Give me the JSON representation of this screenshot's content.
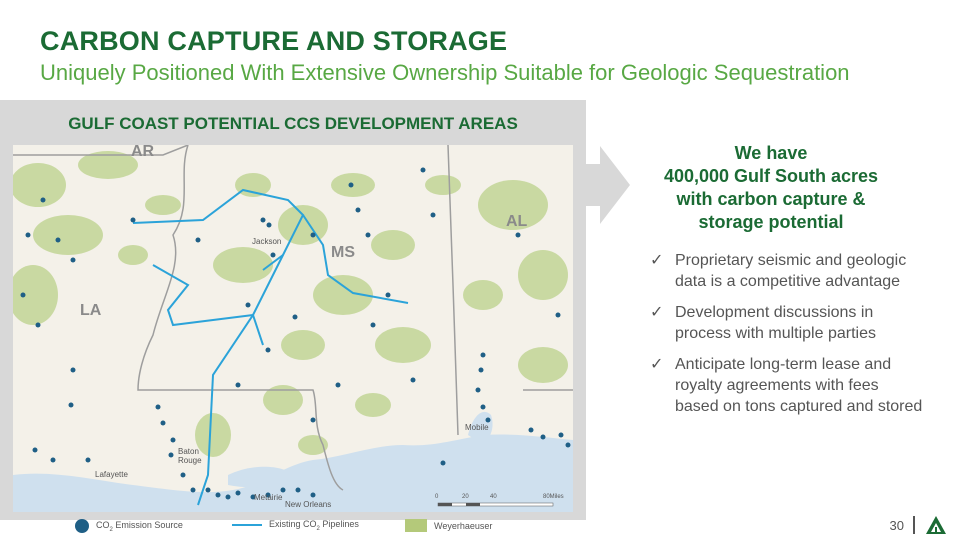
{
  "header": {
    "title": "CARBON CAPTURE AND STORAGE",
    "subtitle": "Uniquely Positioned With Extensive Ownership Suitable for Geologic Sequestration"
  },
  "map_panel": {
    "title": "GULF COAST POTENTIAL CCS DEVELOPMENT AREAS",
    "state_labels": [
      "AR",
      "AL",
      "MS",
      "LA"
    ],
    "city_labels": [
      "Jackson",
      "Mobile",
      "Baton Rouge",
      "Lafayette",
      "Metairie",
      "New Orleans"
    ],
    "scale": {
      "ticks": [
        "0",
        "20",
        "40",
        "80Miles"
      ]
    },
    "colors": {
      "water": "#cfe0ee",
      "land": "#f4f1e9",
      "ownership": "#c9d9a2",
      "pipeline": "#2ba3d9",
      "emission": "#1f5f86",
      "border": "#9e9e9e"
    }
  },
  "legend": {
    "emission_label": "CO",
    "emission_sub": "2",
    "emission_suffix": " Emission Source",
    "pipeline_label": "Existing CO",
    "pipeline_sub": "2",
    "pipeline_suffix": " Pipelines",
    "ownership_label": "Weyerhaeuser"
  },
  "callout": {
    "line1": "We have",
    "line2": "400,000 Gulf South acres",
    "line3": "with carbon capture &",
    "line4": "storage potential"
  },
  "bullets": [
    "Proprietary seismic and geologic data is a competitive advantage",
    "Development discussions in process with multiple parties",
    "Anticipate long-term lease and royalty agreements with fees based on tons captured and stored"
  ],
  "footer": {
    "page_number": "30"
  },
  "logo": {
    "icon": "weyerhaeuser-tree-icon",
    "color": "#1b6b34"
  }
}
